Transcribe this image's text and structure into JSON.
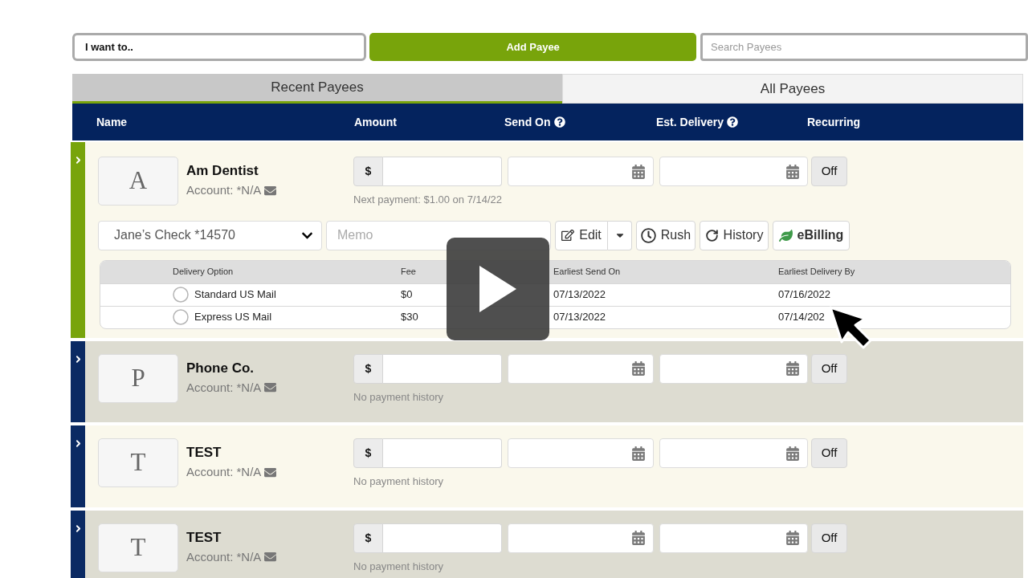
{
  "toolbar": {
    "action_select": "I want to..",
    "add_button": "Add Payee",
    "search": {
      "placeholder": "Search Payees"
    }
  },
  "tabs": [
    {
      "label": "Recent Payees",
      "selected": true
    },
    {
      "label": "All Payees",
      "selected": false
    }
  ],
  "table": {
    "columns": [
      {
        "label": "Name",
        "help": false
      },
      {
        "label": "Amount",
        "help": false
      },
      {
        "label": "Send On",
        "help": true
      },
      {
        "label": "Est. Delivery",
        "help": true
      },
      {
        "label": "Recurring",
        "help": false
      }
    ],
    "rows": [
      {
        "initial": "A",
        "name": "Am Dentist",
        "account": "Account: *N/A",
        "expanded": true,
        "currency": "$",
        "recurring": "Off",
        "note": "Next payment: $1.00 on 7/14/22",
        "details": {
          "funding_account": "Jane’s Check *14570",
          "memo": {
            "placeholder": "Memo"
          },
          "actions": [
            {
              "kind": "edit",
              "label": "Edit"
            },
            {
              "kind": "rush",
              "label": "Rush"
            },
            {
              "kind": "history",
              "label": "History"
            },
            {
              "kind": "ebilling",
              "label": "eBilling"
            }
          ],
          "delivery": {
            "columns": [
              "Delivery Option",
              "Fee",
              "Earliest Send On",
              "Earliest Delivery By"
            ],
            "options": [
              {
                "label": "Standard US Mail",
                "fee": "$0",
                "send_on": "07/13/2022",
                "delivery_by": "07/16/2022",
                "selected": false
              },
              {
                "label": "Express US Mail",
                "fee": "$30",
                "send_on": "07/13/2022",
                "delivery_by": "07/14/202",
                "selected": false
              }
            ]
          }
        }
      },
      {
        "initial": "P",
        "name": "Phone Co.",
        "account": "Account: *N/A",
        "expanded": false,
        "currency": "$",
        "recurring": "Off",
        "note": "No payment history"
      },
      {
        "initial": "T",
        "name": "TEST",
        "account": "Account: *N/A",
        "expanded": false,
        "currency": "$",
        "recurring": "Off",
        "note": "No payment history"
      },
      {
        "initial": "T",
        "name": "TEST",
        "account": "Account: *N/A",
        "expanded": false,
        "currency": "$",
        "recurring": "Off",
        "note": "No payment history"
      }
    ]
  }
}
